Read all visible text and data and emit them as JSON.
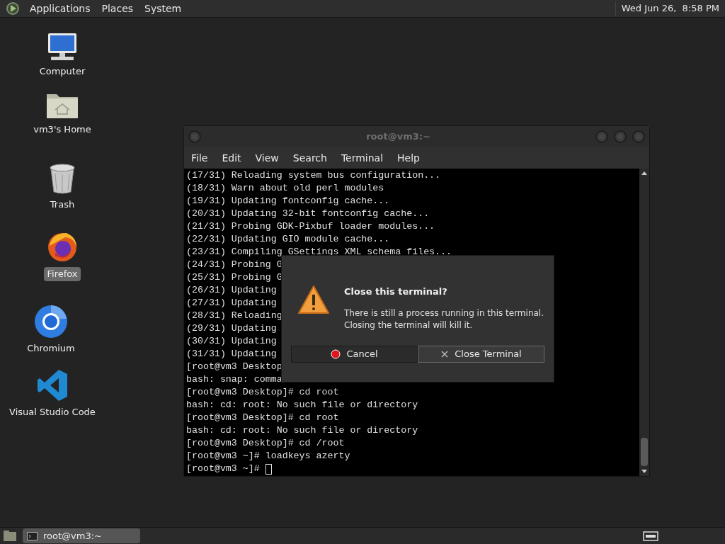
{
  "top_panel": {
    "menus": [
      "Applications",
      "Places",
      "System"
    ],
    "clock": "Wed Jun 26,  8:58 PM"
  },
  "desktop_icons": [
    {
      "kind": "computer",
      "label": "Computer",
      "selected": false
    },
    {
      "kind": "home",
      "label": "vm3's Home",
      "selected": false
    },
    {
      "kind": "trash",
      "label": "Trash",
      "selected": false
    },
    {
      "kind": "firefox",
      "label": "Firefox",
      "selected": true
    },
    {
      "kind": "chromium",
      "label": "Chromium",
      "selected": false
    },
    {
      "kind": "vscode",
      "label": "Visual Studio Code",
      "selected": false
    }
  ],
  "terminal": {
    "title": "root@vm3:~",
    "menu": [
      "File",
      "Edit",
      "View",
      "Search",
      "Terminal",
      "Help"
    ],
    "lines": [
      "(17/31) Reloading system bus configuration...",
      "(18/31) Warn about old perl modules",
      "(19/31) Updating fontconfig cache...",
      "(20/31) Updating 32-bit fontconfig cache...",
      "(21/31) Probing GDK-Pixbuf loader modules...",
      "(22/31) Updating GIO module cache...",
      "(23/31) Compiling GSettings XML schema files...",
      "(24/31) Probing G",
      "(25/31) Probing G",
      "(26/31) Updating",
      "(27/31) Updating",
      "(28/31) Reloading",
      "(29/31) Updating",
      "(30/31) Updating",
      "(31/31) Updating",
      "[root@vm3 Desktop",
      "bash: snap: comma",
      "[root@vm3 Desktop]# cd root",
      "bash: cd: root: No such file or directory",
      "[root@vm3 Desktop]# cd root",
      "bash: cd: root: No such file or directory",
      "[root@vm3 Desktop]# cd /root",
      "[root@vm3 ~]# loadkeys azerty",
      "[root@vm3 ~]# "
    ]
  },
  "dialog": {
    "title": "Close this terminal?",
    "message": "There is still a process running in this terminal.\nClosing the terminal will kill it.",
    "buttons": [
      {
        "kind": "cancel",
        "label": "Cancel"
      },
      {
        "kind": "close",
        "label": "Close Terminal"
      }
    ]
  },
  "taskbar": {
    "tasks": [
      {
        "label": "root@vm3:~",
        "selected": true
      }
    ]
  }
}
